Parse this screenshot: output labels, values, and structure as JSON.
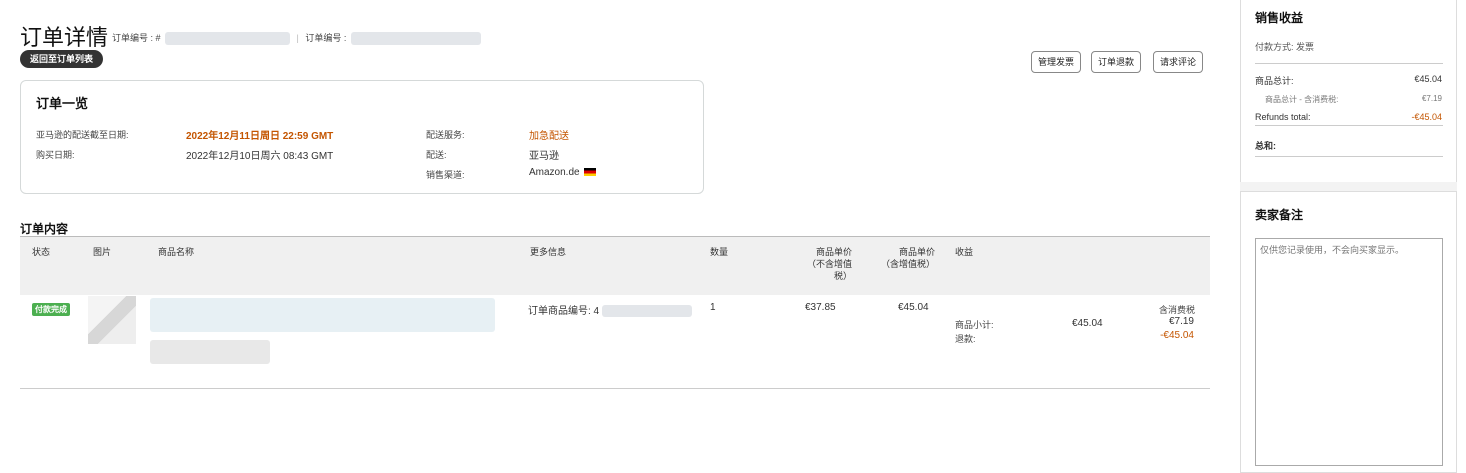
{
  "page": {
    "title": "订单详情",
    "order_no_label_1": "订单编号 : #",
    "order_no_label_2": "订单编号 :",
    "back_button": "返回至订单列表"
  },
  "actions": {
    "manage_invoice": "管理发票",
    "refund": "订单退款",
    "request_review": "请求评论"
  },
  "summary": {
    "title": "订单一览",
    "delivery_deadline_label": "亚马逊的配送截至日期:",
    "delivery_deadline_value": "2022年12月11日周日 22:59 GMT",
    "purchase_date_label": "购买日期:",
    "purchase_date_value": "2022年12月10日周六 08:43 GMT",
    "shipping_service_label": "配送服务:",
    "shipping_service_value": "加急配送",
    "fulfillment_label": "配送:",
    "fulfillment_value": "亚马逊",
    "channel_label": "销售渠道:",
    "channel_value": "Amazon.de"
  },
  "contents": {
    "title": "订单内容",
    "columns": {
      "status": "状态",
      "image": "图片",
      "product_name": "商品名称",
      "more_info": "更多信息",
      "quantity": "数量",
      "unit_price_ex_line1": "商品单价",
      "unit_price_ex_line2": "（不含增值",
      "unit_price_ex_line3": "税）",
      "unit_price_inc_line1": "商品单价",
      "unit_price_inc_line2": "（含增值税）",
      "revenue": "收益"
    },
    "row": {
      "status_badge": "付款完成",
      "more_info": "订单商品编号: 4",
      "quantity": "1",
      "unit_price_ex": "€37.85",
      "unit_price_inc": "€45.04",
      "tax_header": "含消费税",
      "subtotal_label": "商品小计:",
      "subtotal_value": "€45.04",
      "subtotal_tax": "€7.19",
      "refund_label": "退款:",
      "refund_value": "-€45.04"
    }
  },
  "sales": {
    "title": "销售收益",
    "payment_method": "付款方式: 发票",
    "goods_total_label": "商品总计:",
    "goods_total_value": "€45.04",
    "goods_subtotal_tax_label": "商品总计 - 含消费税:",
    "goods_subtotal_tax_value": "€7.19",
    "refunds_total_label": "Refunds total:",
    "refunds_total_value": "-€45.04",
    "sum_label": "总和:"
  },
  "seller_notes": {
    "title": "卖家备注",
    "placeholder": "仅供您记录使用，不会向买家显示。"
  },
  "colors": {
    "accent_orange": "#c45500",
    "badge_green": "#4caf50"
  }
}
